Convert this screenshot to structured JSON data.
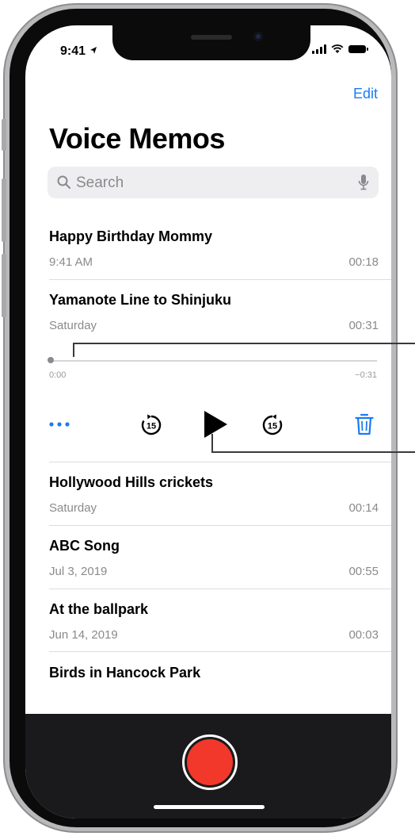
{
  "status": {
    "time": "9:41"
  },
  "nav": {
    "edit_label": "Edit"
  },
  "page": {
    "title": "Voice Memos"
  },
  "search": {
    "placeholder": "Search"
  },
  "memos": [
    {
      "title": "Happy Birthday Mommy",
      "date": "9:41 AM",
      "duration": "00:18"
    },
    {
      "title": "Yamanote Line to Shinjuku",
      "date": "Saturday",
      "duration": "00:31"
    },
    {
      "title": "Hollywood Hills crickets",
      "date": "Saturday",
      "duration": "00:14"
    },
    {
      "title": "ABC Song",
      "date": "Jul 3, 2019",
      "duration": "00:55"
    },
    {
      "title": "At the ballpark",
      "date": "Jun 14, 2019",
      "duration": "00:03"
    },
    {
      "title": "Birds in Hancock Park"
    }
  ],
  "player": {
    "elapsed": "0:00",
    "remaining": "−0:31",
    "playback_progress": 0,
    "skip_back_seconds": "15",
    "skip_forward_seconds": "15"
  },
  "colors": {
    "accent": "#1b7bf2",
    "record": "#f2382b",
    "record_bar": "#1a1a1c"
  },
  "icons": [
    "search-icon",
    "mic-icon",
    "more-icon",
    "skip-back-15-icon",
    "play-icon",
    "skip-forward-15-icon",
    "trash-icon",
    "record-icon"
  ]
}
